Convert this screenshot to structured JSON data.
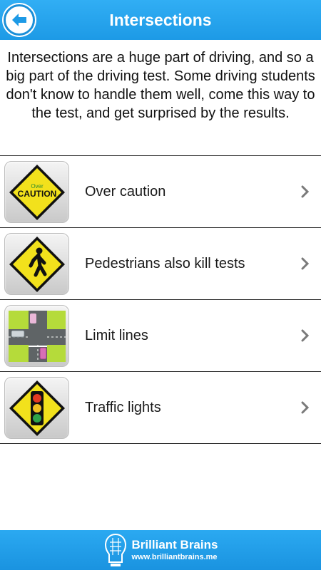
{
  "header": {
    "title": "Intersections",
    "back_icon": "back-arrow-icon"
  },
  "intro": {
    "text": "Intersections are a huge part of driving, and so a big part of the driving test. Some driving students don't know to handle them well, come this way to the test, and get surprised by the results."
  },
  "list": {
    "items": [
      {
        "label": "Over caution",
        "icon": "caution-sign-icon",
        "icon_text_top": "Over",
        "icon_text_main": "CAUTION"
      },
      {
        "label": "Pedestrians also kill tests",
        "icon": "pedestrian-sign-icon"
      },
      {
        "label": "Limit lines",
        "icon": "intersection-map-icon"
      },
      {
        "label": "Traffic lights",
        "icon": "traffic-light-sign-icon"
      }
    ]
  },
  "footer": {
    "brand_name": "Brilliant Brains",
    "brand_url": "www.brilliantbrains.me",
    "logo_icon": "brain-head-logo-icon"
  },
  "colors": {
    "header_blue": "#1d9ae6",
    "sign_yellow": "#f2e11c",
    "divider": "#2a2a2a"
  }
}
